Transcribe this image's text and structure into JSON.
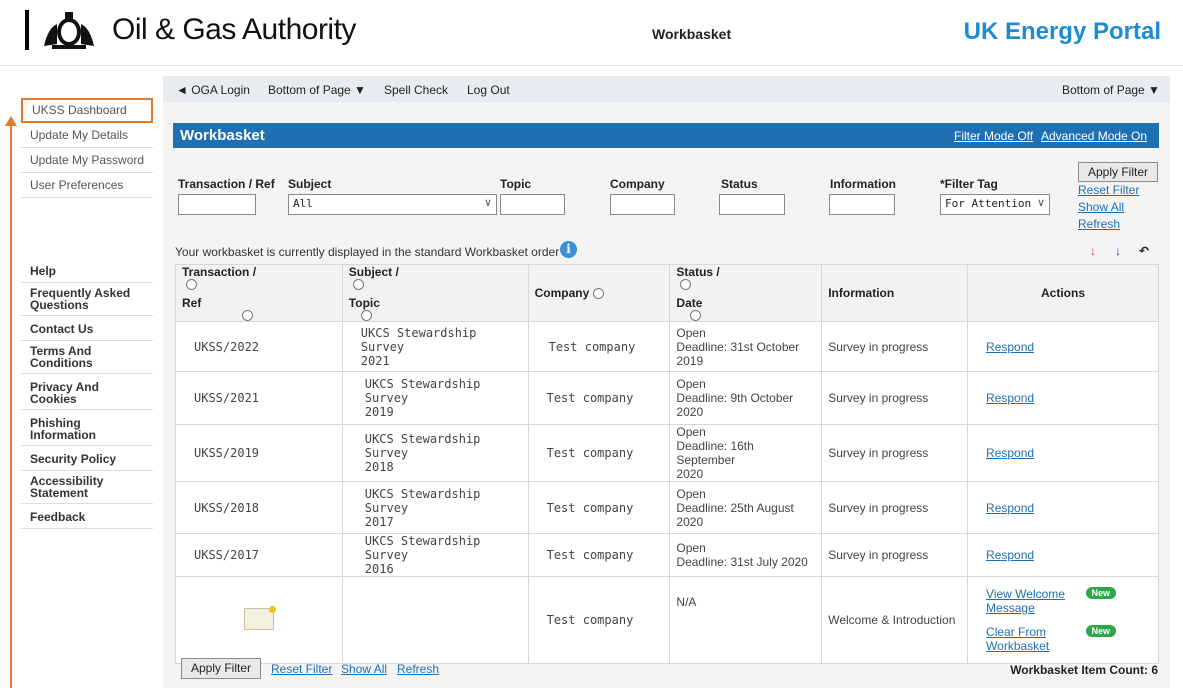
{
  "header": {
    "brand": "Oil & Gas Authority",
    "center_title": "Workbasket",
    "portal": "UK Energy Portal"
  },
  "sidebar": {
    "items": [
      {
        "label": "UKSS Dashboard",
        "active": true
      },
      {
        "label": "Update My Details"
      },
      {
        "label": "Update My Password"
      },
      {
        "label": "User Preferences"
      }
    ],
    "help_items": [
      {
        "label": "Help"
      },
      {
        "label": "Frequently Asked Questions"
      },
      {
        "label": "Contact Us"
      },
      {
        "label": "Terms And Conditions"
      },
      {
        "label": "Privacy And Cookies"
      },
      {
        "label": "Phishing Information"
      },
      {
        "label": "Security Policy"
      },
      {
        "label": "Accessibility Statement"
      },
      {
        "label": "Feedback"
      }
    ]
  },
  "topnav": {
    "oga_login": "◄ OGA Login",
    "bottom_of_page": "Bottom of Page ▼",
    "spell_check": "Spell Check",
    "log_out": "Log Out",
    "bottom_of_page_right": "Bottom of Page ▼"
  },
  "panel": {
    "title": "Workbasket",
    "filter_mode": "Filter Mode Off",
    "advanced_mode": "Advanced Mode On"
  },
  "filters": {
    "transaction_label": "Transaction / Ref",
    "subject_label": "Subject",
    "subject_value": "All",
    "topic_label": "Topic",
    "company_label": "Company",
    "status_label": "Status",
    "information_label": "Information",
    "filter_tag_label": "*Filter Tag",
    "filter_tag_value": "For Attention",
    "apply_filter": "Apply Filter",
    "reset_filter": "Reset Filter",
    "show_all": "Show All",
    "refresh": "Refresh"
  },
  "order_text": "Your workbasket is currently displayed in the standard Workbasket order",
  "table": {
    "headers": {
      "transaction": "Transaction /",
      "ref": "Ref",
      "subject": "Subject /",
      "topic": "Topic",
      "company": "Company",
      "status": "Status /",
      "date": "Date",
      "information": "Information",
      "actions": "Actions"
    },
    "rows": [
      {
        "ref": "UKSS/2022",
        "subject": "UKCS Stewardship Survey",
        "topic": "2021",
        "company": "Test company",
        "status": "Open",
        "deadline": "Deadline: 31st October",
        "deadline_year": "2019",
        "info": "Survey in progress",
        "action": "Respond"
      },
      {
        "ref": "UKSS/2021",
        "subject": "UKCS Stewardship Survey",
        "topic": "2019",
        "company": "Test company",
        "status": "Open",
        "deadline": "Deadline: 9th October",
        "deadline_year": "2020",
        "info": "Survey in progress",
        "action": "Respond"
      },
      {
        "ref": "UKSS/2019",
        "subject": "UKCS Stewardship Survey",
        "topic": "2018",
        "company": "Test company",
        "status": "Open",
        "deadline": "Deadline: 16th September",
        "deadline_year": "2020",
        "info": "Survey in progress",
        "action": "Respond"
      },
      {
        "ref": "UKSS/2018",
        "subject": "UKCS Stewardship Survey",
        "topic": "2017",
        "company": "Test company",
        "status": "Open",
        "deadline": "Deadline: 25th August",
        "deadline_year": "2020",
        "info": "Survey in progress",
        "action": "Respond"
      },
      {
        "ref": "UKSS/2017",
        "subject": "UKCS Stewardship Survey",
        "topic": "2016",
        "company": "Test company",
        "status": "Open",
        "deadline": "Deadline: 31st July 2020",
        "deadline_year": "",
        "info": "Survey in progress",
        "action": "Respond"
      }
    ],
    "welcome_row": {
      "company": "Test company",
      "status": "N/A",
      "info": "Welcome & Introduction",
      "view_welcome": "View Welcome Message",
      "clear": "Clear From Workbasket",
      "badge": "New"
    }
  },
  "bottom": {
    "apply_filter": "Apply Filter",
    "reset_filter": "Reset Filter",
    "show_all": "Show All",
    "refresh": "Refresh",
    "item_count": "Workbasket Item Count: 6"
  },
  "colors": {
    "accent": "#1f6fb3",
    "portal": "#1f8ccf",
    "highlight": "#e07a2c",
    "new_badge": "#2aa84a"
  }
}
